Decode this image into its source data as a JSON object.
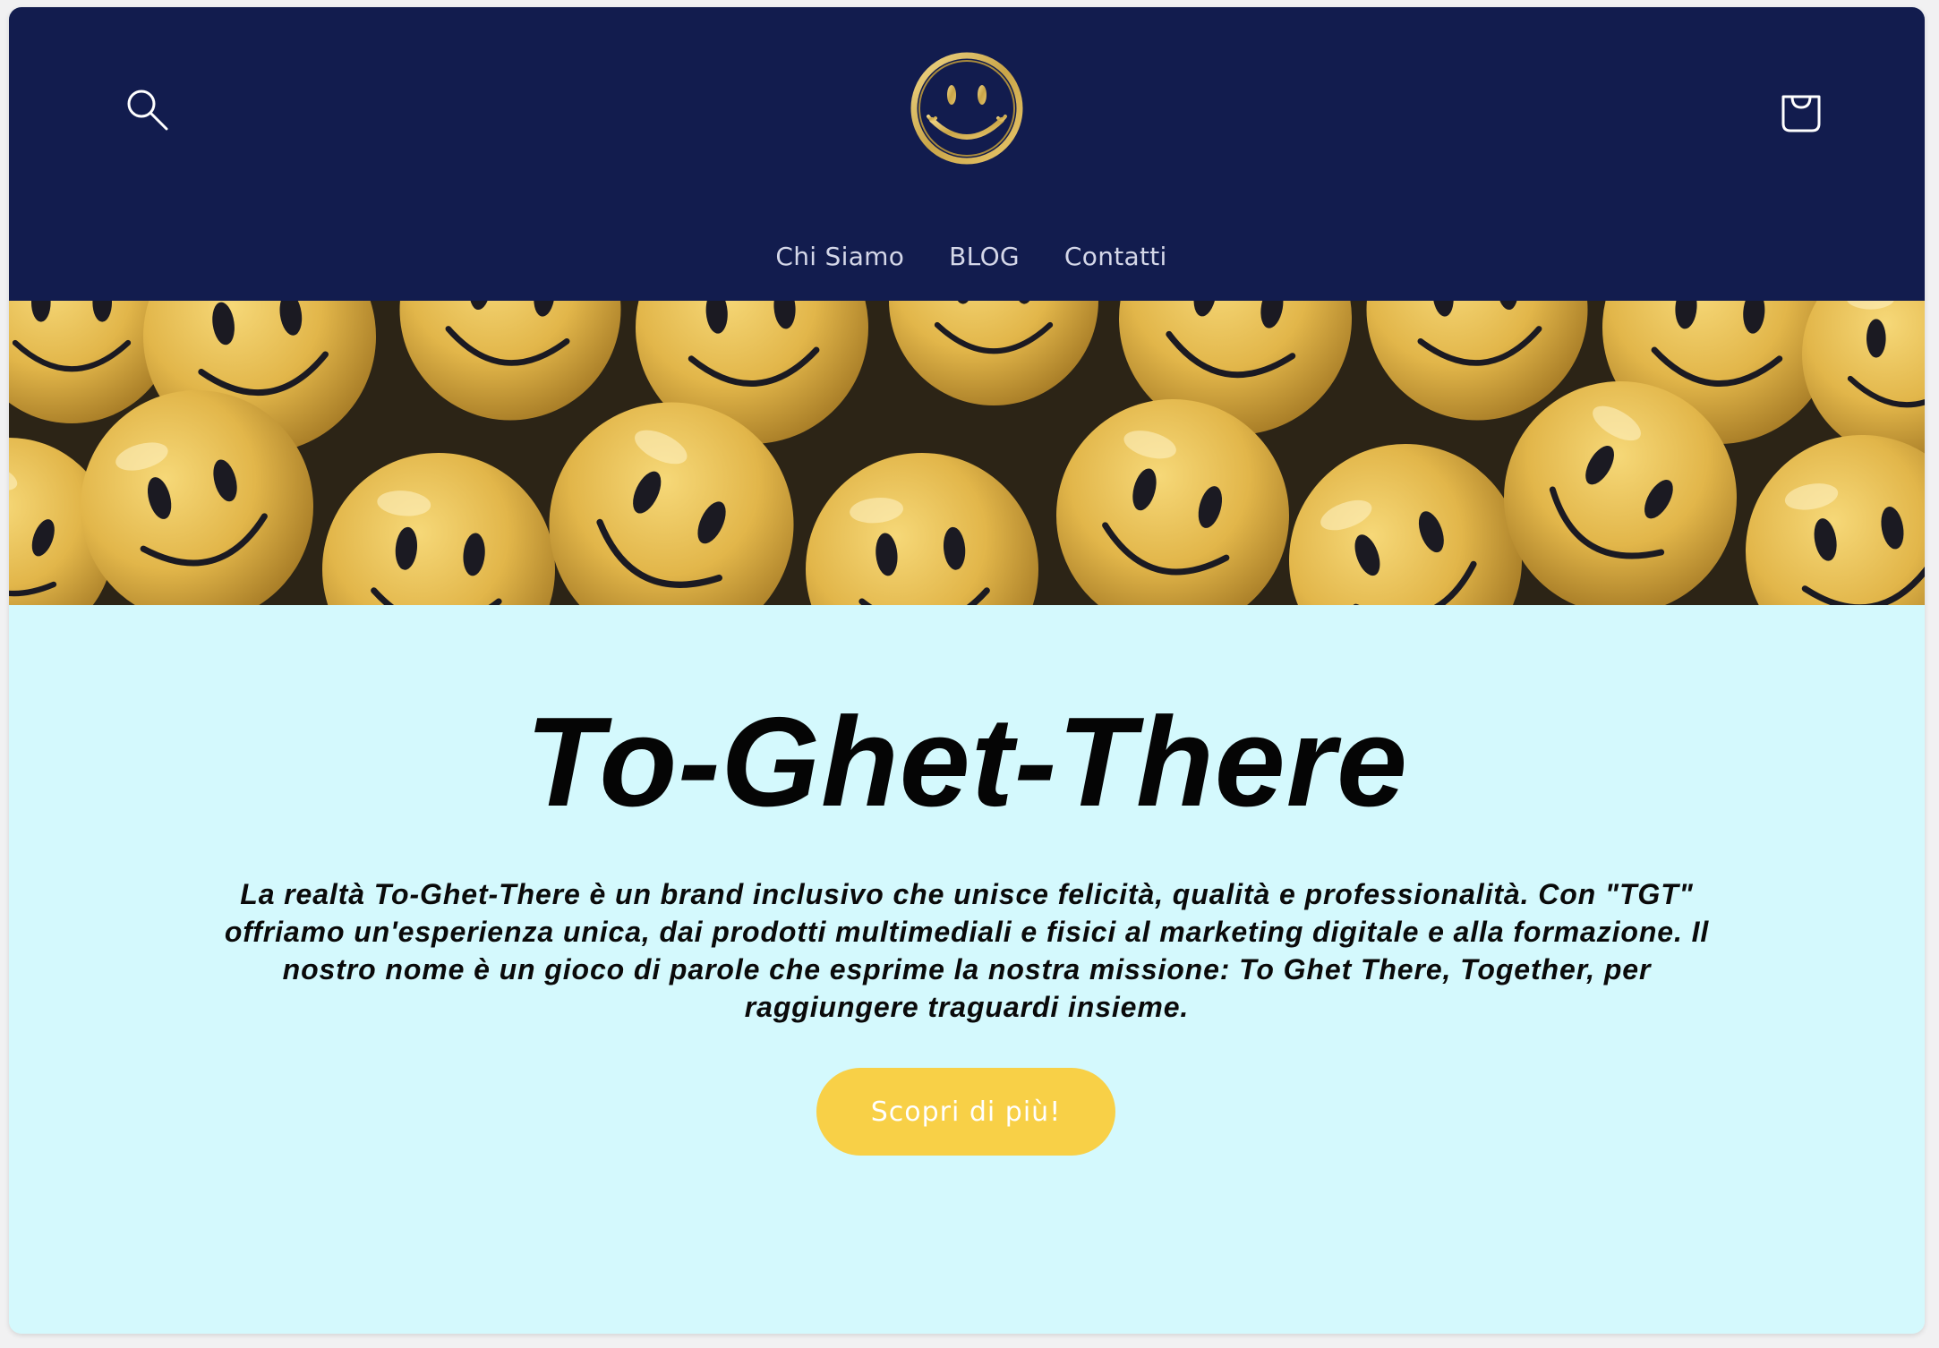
{
  "header": {
    "search_icon": "search-icon",
    "logo_icon": "smiley-logo-icon",
    "cart_icon": "shopping-bag-icon",
    "background_color": "#121c4e",
    "logo_color": "#c9a548"
  },
  "nav": {
    "items": [
      {
        "label": "Chi Siamo"
      },
      {
        "label": "BLOG"
      },
      {
        "label": "Contatti"
      }
    ]
  },
  "banner": {
    "image": "yellow smiley balls photo"
  },
  "hero": {
    "title": "To-Ghet-There",
    "description": "La realtà To-Ghet-There è un brand inclusivo che unisce felicità, qualità e professionalità. Con \"TGT\" offriamo un'esperienza unica, dai prodotti multimediali e fisici al marketing digitale e alla formazione. Il nostro nome è un gioco di parole che esprime la nostra missione: To Ghet There, Together, per raggiungere traguardi insieme.",
    "cta_label": "Scopri di più!",
    "background_color": "#d4f9fd",
    "cta_color": "#f8d047"
  }
}
